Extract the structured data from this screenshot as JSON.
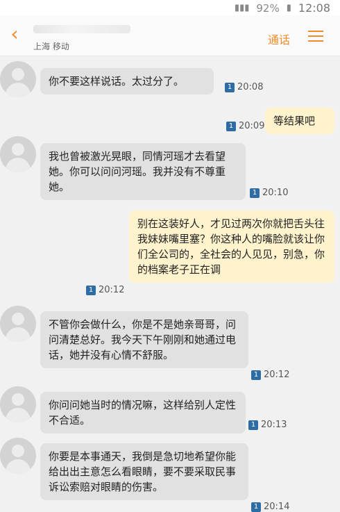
{
  "status_bar": {
    "battery": "92%",
    "time": "12:08"
  },
  "header": {
    "carrier": "上海 移动",
    "call_label": "通话"
  },
  "messages": [
    {
      "dir": "in",
      "text": "你不要这样说话。太过分了。",
      "time": "20:08",
      "sim": "1"
    },
    {
      "dir": "out",
      "text": "等结果吧",
      "time": "20:09",
      "sim": "1"
    },
    {
      "dir": "in",
      "text": "我也曾被激光晃眼，同情河瑶才去看望她。你可以问问河瑶。我并没有不尊重她。",
      "time": "20:10",
      "sim": "1"
    },
    {
      "dir": "out",
      "text": "别在这装好人，才见过两次你就把舌头往我妹妹嘴里塞？你这种人的嘴脸就该让你们全公司的，全社会的人见见，别急，你的档案老子正在调",
      "time": "20:12",
      "sim": "1"
    },
    {
      "dir": "in",
      "text": "不管你会做什么，你是不是她亲哥哥，问问清楚总好。我今天下午刚刚和她通过电话，她并没有心情不舒服。",
      "time": "20:12",
      "sim": "1"
    },
    {
      "dir": "in",
      "text": "你问问她当时的情况嘛，这样给别人定性不合适。",
      "time": "20:13",
      "sim": "1"
    },
    {
      "dir": "in",
      "text": "你要是本事通天，我倒是急切地希望你能给出出主意怎么看眼睛，要不要采取民事诉讼索赔对眼睛的伤害。",
      "time": "20:14",
      "sim": "1"
    }
  ]
}
